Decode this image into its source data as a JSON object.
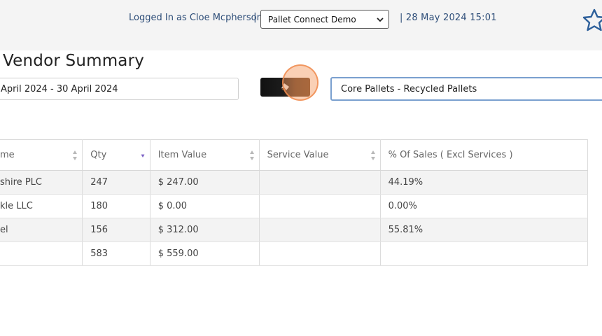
{
  "header": {
    "logged_in_text": "Logged In as Cloe Mcpherson",
    "separator": "|",
    "company_selected": "Pallet Connect Demo",
    "datetime": "| 28 May 2024 15:01"
  },
  "page": {
    "title": "Vendor Summary",
    "date_range": "April 2024 - 30 April 2024",
    "vendor_filter": "Core Pallets - Recycled Pallets"
  },
  "table": {
    "columns": [
      "me",
      "Qty",
      "Item Value",
      "Service Value",
      "% Of Sales ( Excl Services )"
    ],
    "rows": [
      [
        "shire PLC",
        "247",
        "$ 247.00",
        "",
        "44.19%"
      ],
      [
        "kle LLC",
        "180",
        "$ 0.00",
        "",
        "0.00%"
      ],
      [
        "el",
        "156",
        "$ 312.00",
        "",
        "55.81%"
      ]
    ],
    "totals": [
      "",
      "583",
      "$ 559.00",
      "",
      ""
    ]
  },
  "colors": {
    "header_text": "#2d4d78",
    "sort_active": "#7a5fc4",
    "focus_border": "#7aa0cf",
    "click_highlight": "#f5965a"
  },
  "icons": {
    "star": "star-outline-icon",
    "clear": "eraser-icon",
    "sort": "sort-arrows-icon"
  }
}
